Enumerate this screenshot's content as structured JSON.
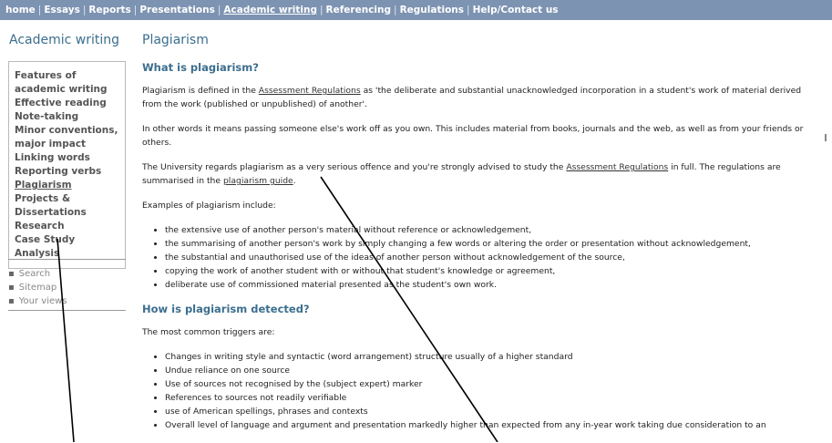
{
  "topnav": {
    "items": [
      "home",
      "Essays",
      "Reports",
      "Presentations",
      "Academic writing",
      "Referencing",
      "Regulations",
      "Help/Contact us"
    ]
  },
  "sidebar": {
    "title": "Academic writing",
    "items": [
      "Features of academic writing",
      "Effective reading",
      "Note-taking",
      "Minor conventions, major impact",
      "Linking words",
      "Reporting verbs",
      "Plagiarism",
      "Projects & Dissertations",
      "Research",
      "Case Study Analysis"
    ],
    "utils": [
      "Search",
      "Sitemap",
      "Your views"
    ]
  },
  "main": {
    "title": "Plagiarism",
    "h1": "What is plagiarism?",
    "p1_a": "Plagiarism is defined in the ",
    "p1_link": "Assessment Regulations",
    "p1_b": " as 'the deliberate and substantial unacknowledged incorporation in a student's work of material derived from the work (published or unpublished) of another'.",
    "p2": "In other words it means passing someone else's work off as you own. This includes material from books, journals and the web, as well as from your friends or others.",
    "p3_a": "The University regards plagiarism as a very serious offence and you're strongly advised to study the ",
    "p3_link1": "Assessment Regulations",
    "p3_b": " in full. The regulations are summarised in the ",
    "p3_link2": "plagiarism guide",
    "p3_c": ".",
    "p4": "Examples of plagiarism include:",
    "examples": [
      "the extensive use of another person's material without reference or acknowledgement,",
      "the summarising of another person's work by simply changing a few words or altering the order or presentation without acknowledgement,",
      "the substantial and unauthorised use of the ideas of another person without acknowledgement of the source,",
      "copying the work of another student with or without that student's knowledge or agreement,",
      "deliberate use of commissioned material presented as the student's own work."
    ],
    "h2": "How is plagiarism detected?",
    "p5": "The most common triggers are:",
    "triggers": [
      "Changes in writing style and syntactic (word arrangement) structure usually of a higher standard",
      "Undue reliance on one source",
      "Use of sources not recognised by the (subject expert) marker",
      "References to sources not readily verifiable",
      "use of American spellings, phrases and contexts",
      "Overall level of language and argument and presentation markedly higher than expected from any in-year work taking due consideration to an"
    ]
  }
}
